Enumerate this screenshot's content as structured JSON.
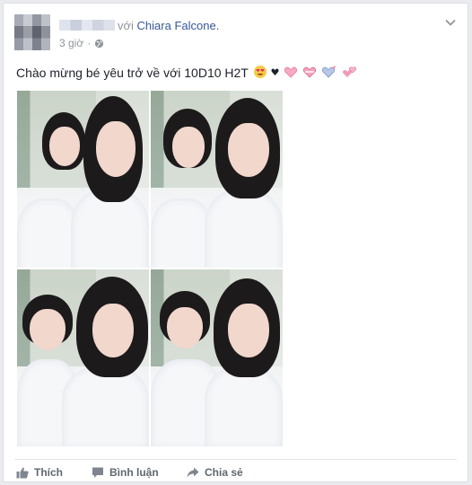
{
  "post": {
    "with_text": "với",
    "tagged_name": "Chiara Falcone.",
    "time": "3 giờ",
    "privacy_icon": "globe-icon",
    "options_icon": "chevron-down-icon",
    "message": "Chào mừng bé yêu trở về với 10D10 H2T",
    "emojis": [
      "heart-eyes-emoji",
      "black-heart-emoji",
      "pink-heart-emoji",
      "heart-ribbon-emoji",
      "heart-gift-emoji",
      "two-hearts-emoji"
    ]
  },
  "actions": {
    "like": "Thích",
    "comment": "Bình luận",
    "share": "Chia sẻ"
  },
  "colors": {
    "link": "#365899",
    "meta": "#90949c",
    "action": "#616770"
  }
}
